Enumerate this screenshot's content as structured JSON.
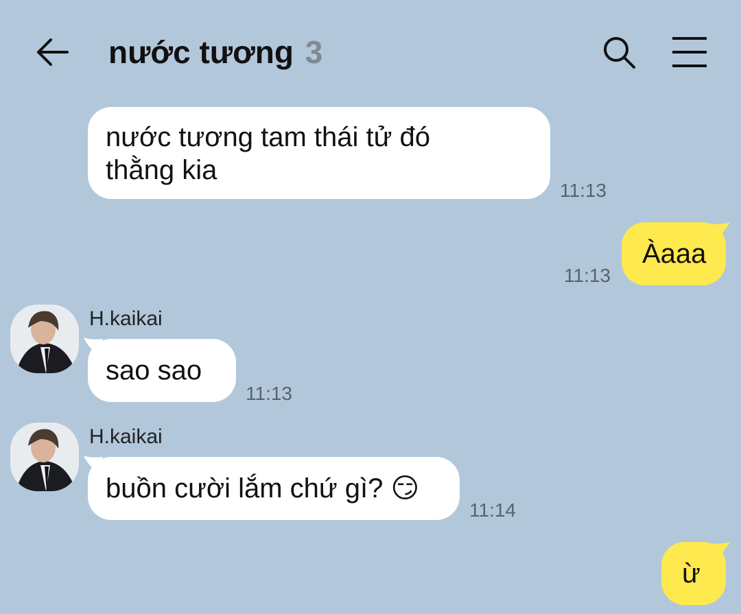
{
  "header": {
    "title": "nước tương",
    "member_count": "3"
  },
  "messages": [
    {
      "sender": "",
      "text_line1": "nước tương tam thái tử đó",
      "text_line2": "thằng kia",
      "time": "11:13"
    },
    {
      "sender": "me",
      "text": "Àaaa",
      "time": "11:13"
    },
    {
      "sender": "H.kaikai",
      "text": "sao sao",
      "time": "11:13"
    },
    {
      "sender": "H.kaikai",
      "text": "buồn cười lắm chứ gì? 😏",
      "time": "11:14"
    },
    {
      "sender": "me",
      "text": "ừ",
      "time": ""
    }
  ],
  "colors": {
    "background": "#b2c7da",
    "incoming_bubble": "#ffffff",
    "outgoing_bubble": "#fee94e",
    "timestamp": "#59636d",
    "member_count": "#7d8a96"
  },
  "icons": {
    "back": "arrow-left",
    "search": "magnifier",
    "menu": "hamburger"
  }
}
